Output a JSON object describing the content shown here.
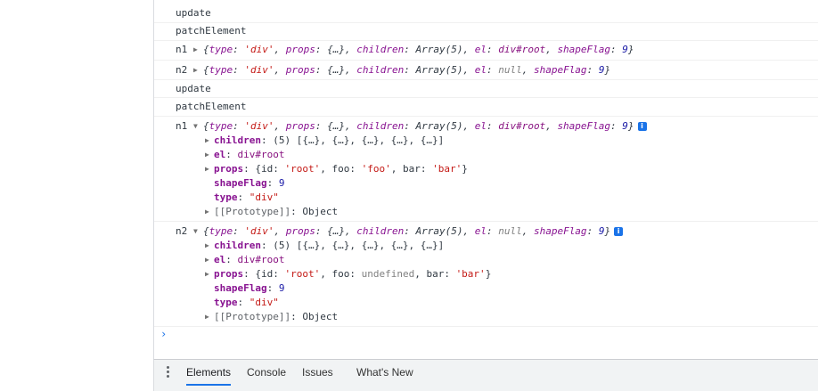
{
  "console": {
    "messages": [
      {
        "text": "update"
      },
      {
        "text": "patchElement"
      },
      {
        "label": "n1",
        "summary": {
          "type": "'div'",
          "el": "div#root",
          "shapeFlag": "9"
        }
      },
      {
        "label": "n2",
        "summary": {
          "type": "'div'",
          "el": "null",
          "shapeFlag": "9"
        }
      },
      {
        "text": "update"
      },
      {
        "text": "patchElement"
      }
    ],
    "n1_expanded": {
      "label": "n1",
      "summary": {
        "type": "'div'",
        "el": "div#root",
        "shapeFlag": "9"
      },
      "children": "(5) [{…}, {…}, {…}, {…}, {…}]",
      "el": "div#root",
      "props": {
        "id": "'root'",
        "foo": "'foo'",
        "bar": "'bar'"
      },
      "shapeFlag": "9",
      "type": "\"div\"",
      "prototype": "Object"
    },
    "n2_expanded": {
      "label": "n2",
      "summary": {
        "type": "'div'",
        "el": "null",
        "shapeFlag": "9"
      },
      "children": "(5) [{…}, {…}, {…}, {…}, {…}]",
      "el": "div#root",
      "props": {
        "id": "'root'",
        "foo": "undefined",
        "bar": "'bar'"
      },
      "shapeFlag": "9",
      "type": "\"div\"",
      "prototype": "Object"
    },
    "prompt_symbol": "›"
  },
  "drawer": {
    "tabs": [
      "Elements",
      "Console",
      "Issues",
      "What's New"
    ],
    "active_tab": "Elements"
  },
  "colors": {
    "accent": "#1a73e8",
    "key": "#881391",
    "string": "#c41a16",
    "number": "#1a1aa6"
  }
}
